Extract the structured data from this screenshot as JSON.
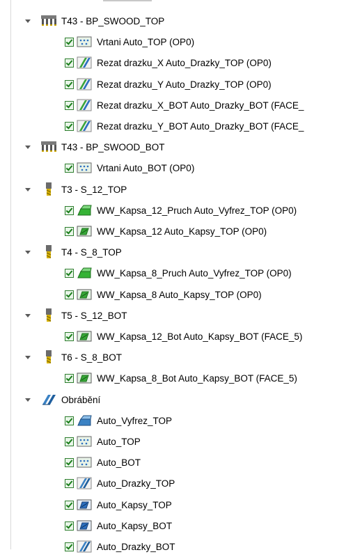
{
  "tree": [
    {
      "type": "group",
      "label": "T43 - BP_SWOOD_TOP",
      "icon": "drill-head-icon",
      "children": [
        {
          "label": "Vrtani Auto_TOP  (OP0)",
          "icon": "drilling-op-icon"
        },
        {
          "label": "Rezat drazku_X Auto_Drazky_TOP  (OP0)",
          "icon": "groove-op-icon"
        },
        {
          "label": "Rezat drazku_Y Auto_Drazky_TOP  (OP0)",
          "icon": "groove-op-icon"
        },
        {
          "label": "Rezat drazku_X_BOT Auto_Drazky_BOT  (FACE_",
          "icon": "groove-op-icon"
        },
        {
          "label": "Rezat drazku_Y_BOT Auto_Drazky_BOT  (FACE_",
          "icon": "groove-op-icon"
        }
      ]
    },
    {
      "type": "group",
      "label": "T43 - BP_SWOOD_BOT",
      "icon": "drill-head-icon",
      "children": [
        {
          "label": "Vrtani Auto_BOT  (OP0)",
          "icon": "drilling-op-icon"
        }
      ]
    },
    {
      "type": "group",
      "label": "T3 - S_12_TOP",
      "icon": "end-mill-icon",
      "children": [
        {
          "label": "WW_Kapsa_12_Pruch Auto_Vyfrez_TOP  (OP0)",
          "icon": "contour-op-icon"
        },
        {
          "label": "WW_Kapsa_12 Auto_Kapsy_TOP  (OP0)",
          "icon": "pocket-op-icon"
        }
      ]
    },
    {
      "type": "group",
      "label": "T4 - S_8_TOP",
      "icon": "end-mill-icon",
      "children": [
        {
          "label": "WW_Kapsa_8_Pruch Auto_Vyfrez_TOP  (OP0)",
          "icon": "contour-op-icon"
        },
        {
          "label": "WW_Kapsa_8 Auto_Kapsy_TOP  (OP0)",
          "icon": "pocket-op-icon"
        }
      ]
    },
    {
      "type": "group",
      "label": "T5 - S_12_BOT",
      "icon": "end-mill-icon",
      "children": [
        {
          "label": "WW_Kapsa_12_Bot Auto_Kapsy_BOT  (FACE_5)",
          "icon": "pocket-op-icon"
        }
      ]
    },
    {
      "type": "group",
      "label": "T6 - S_8_BOT",
      "icon": "end-mill-icon",
      "children": [
        {
          "label": "WW_Kapsa_8_Bot Auto_Kapsy_BOT  (FACE_5)",
          "icon": "pocket-op-icon"
        }
      ]
    },
    {
      "type": "group",
      "label": "Obrábění",
      "icon": "machining-icon",
      "children": [
        {
          "label": "Auto_Vyfrez_TOP",
          "icon": "contour-blue-icon"
        },
        {
          "label": "Auto_TOP",
          "icon": "drilling-op-icon"
        },
        {
          "label": "Auto_BOT",
          "icon": "drilling-op-icon"
        },
        {
          "label": "Auto_Drazky_TOP",
          "icon": "groove-blue-icon"
        },
        {
          "label": "Auto_Kapsy_TOP",
          "icon": "pocket-blue-icon"
        },
        {
          "label": "Auto_Kapsy_BOT",
          "icon": "pocket-blue-icon"
        },
        {
          "label": "Auto_Drazky_BOT",
          "icon": "groove-blue-icon"
        }
      ]
    }
  ]
}
